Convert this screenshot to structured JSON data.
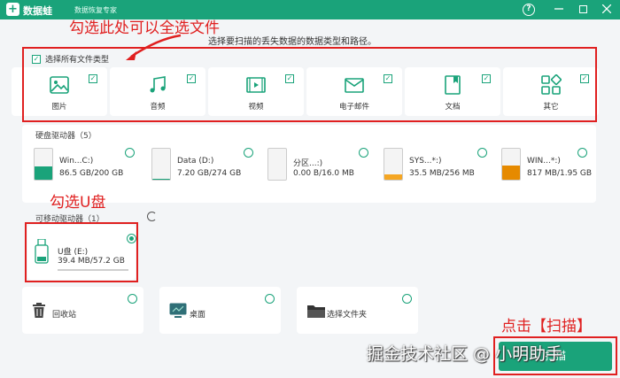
{
  "app": {
    "name": "数据蛙",
    "subtitle": "数据恢复专家",
    "help": "?",
    "logo_symbol": "+",
    "brand_color": "#1aa37a"
  },
  "annotations": {
    "select_all_hint": "勾选此处可以全选文件",
    "u_disk_hint": "勾选U盘",
    "scan_hint": "点击【扫描】",
    "color": "#e02020"
  },
  "instruction": "选择要扫描的丢失数据的数据类型和路径。",
  "file_types": {
    "select_all_label": "选择所有文件类型",
    "select_all_checked": true,
    "items": [
      {
        "label": "图片",
        "icon": "image-icon",
        "checked": true
      },
      {
        "label": "音频",
        "icon": "music-icon",
        "checked": true
      },
      {
        "label": "视频",
        "icon": "video-icon",
        "checked": true
      },
      {
        "label": "电子邮件",
        "icon": "email-icon",
        "checked": true
      },
      {
        "label": "文档",
        "icon": "document-icon",
        "checked": true
      },
      {
        "label": "其它",
        "icon": "other-icon",
        "checked": true
      }
    ]
  },
  "hard_drives": {
    "title": "硬盘驱动器（5）",
    "items": [
      {
        "name": "Win...C:)",
        "size": "86.5 GB/200 GB",
        "used_fraction": 0.43,
        "fill_color": "#1aa37a"
      },
      {
        "name": "Data (D:)",
        "size": "7.20 GB/274 GB",
        "used_fraction": 0.03,
        "fill_color": "#1aa37a"
      },
      {
        "name": "分区...:)",
        "size": "0.00  B/16.0 MB",
        "used_fraction": 0.0,
        "fill_color": "#1aa37a"
      },
      {
        "name": "SYS...*:)",
        "size": "35.5 MB/256 MB",
        "used_fraction": 0.14,
        "fill_color": "#f5a623"
      },
      {
        "name": "WIN...*:)",
        "size": "817 MB/1.95 GB",
        "used_fraction": 0.42,
        "fill_color": "#e68a00"
      }
    ]
  },
  "removable_drives": {
    "title": "可移动驱动器（1）",
    "items": [
      {
        "name": "U盘 (E:)",
        "size": "39.4 MB/57.2 GB",
        "selected": true,
        "used_fraction": 0.01
      }
    ]
  },
  "locations": [
    {
      "label": "回收站",
      "icon": "recycle-bin-icon"
    },
    {
      "label": "桌面",
      "icon": "desktop-icon"
    },
    {
      "label": "选择文件夹",
      "icon": "folder-icon"
    }
  ],
  "scan_button": "扫描",
  "watermark": "掘金技术社区 @ 小明助手"
}
